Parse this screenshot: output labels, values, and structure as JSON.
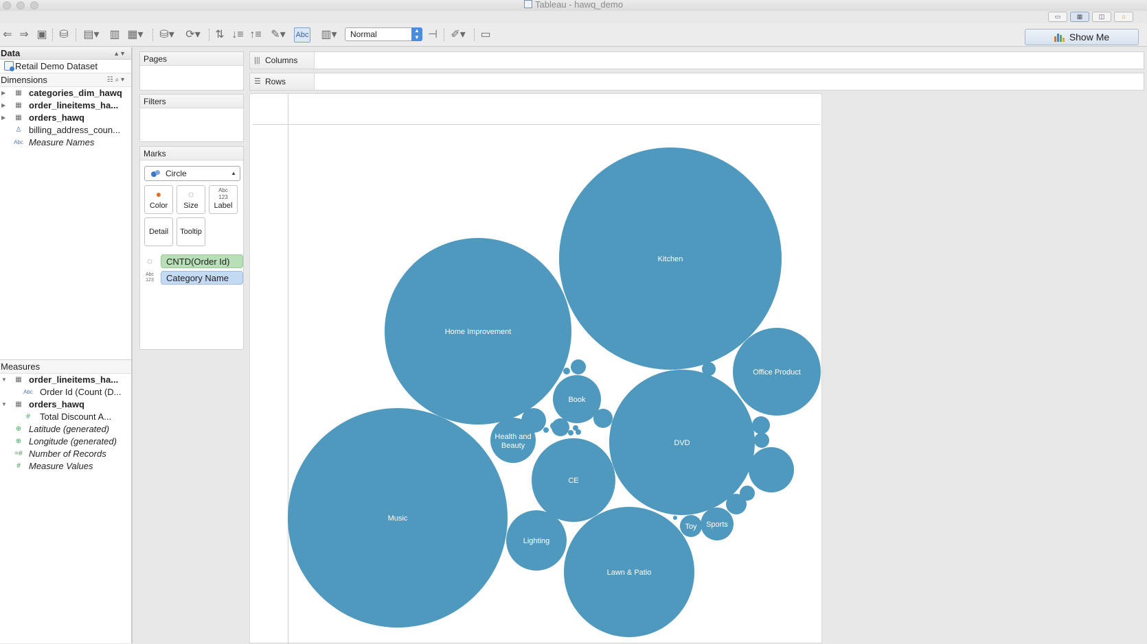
{
  "window": {
    "title": "Tableau - hawq_demo"
  },
  "toolbar": {
    "fit_value": "Normal",
    "label_toggle": "Abc",
    "show_me_label": "Show Me"
  },
  "data_pane": {
    "header": "Data",
    "datasource": "Retail Demo Dataset",
    "dimensions_title": "Dimensions",
    "dimensions": [
      {
        "name": "categories_dim_hawq",
        "kind": "table"
      },
      {
        "name": "order_lineitems_ha...",
        "kind": "table"
      },
      {
        "name": "orders_hawq",
        "kind": "table"
      },
      {
        "name": "billing_address_coun...",
        "kind": "hierarchy"
      },
      {
        "name": "Measure Names",
        "kind": "abc-italic"
      }
    ],
    "measures_title": "Measures",
    "measures": [
      {
        "name": "order_lineitems_ha...",
        "kind": "table"
      },
      {
        "name": "Order Id (Count (D...",
        "kind": "abc-child"
      },
      {
        "name": "orders_hawq",
        "kind": "table"
      },
      {
        "name": "Total Discount A...",
        "kind": "number-child"
      },
      {
        "name": "Latitude (generated)",
        "kind": "geo"
      },
      {
        "name": "Longitude (generated)",
        "kind": "geo"
      },
      {
        "name": "Number of Records",
        "kind": "number-calc"
      },
      {
        "name": "Measure Values",
        "kind": "number"
      }
    ]
  },
  "shelves": {
    "pages": "Pages",
    "filters": "Filters",
    "marks": "Marks",
    "mark_type": "Circle",
    "mark_buttons": {
      "color": "Color",
      "size": "Size",
      "label": "Label",
      "detail": "Detail",
      "tooltip": "Tooltip"
    },
    "pills": {
      "size_pill": "CNTD(Order Id)",
      "label_pill": "Category Name"
    },
    "columns": "Columns",
    "rows": "Rows"
  },
  "colors": {
    "bubble": "#4f98be",
    "pill_green": "#b8dfb8",
    "pill_blue": "#c3d9f4"
  },
  "chart_data": {
    "type": "bubble",
    "title": "",
    "size_measure": "CNTD(Order Id)",
    "label_field": "Category Name",
    "labeled_categories": [
      "Kitchen",
      "Home Improvement",
      "Music",
      "DVD",
      "Office Product",
      "Lawn & Patio",
      "CE",
      "Book",
      "Health and Beauty",
      "Lighting",
      "Sports",
      "Toy"
    ]
  }
}
